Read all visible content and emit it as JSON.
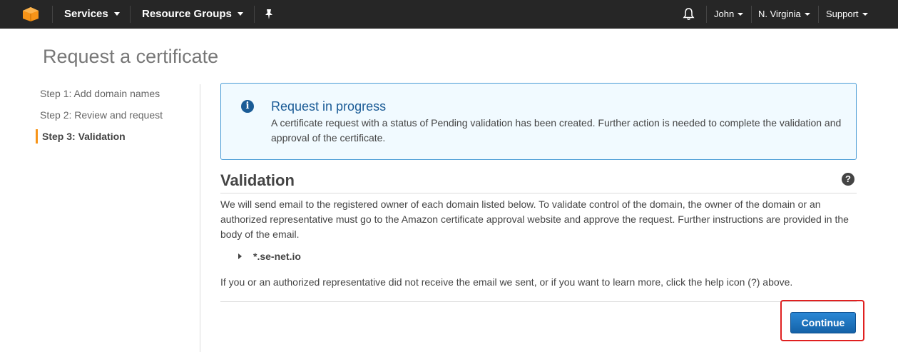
{
  "nav": {
    "logo_icon": "aws-cube-icon",
    "services_label": "Services",
    "resource_groups_label": "Resource Groups",
    "pin_icon": "pin-icon",
    "bell_icon": "bell-icon",
    "user_label": "John",
    "region_label": "N. Virginia",
    "support_label": "Support"
  },
  "page": {
    "title": "Request a certificate"
  },
  "steps": [
    {
      "label": "Step 1: Add domain names",
      "active": false
    },
    {
      "label": "Step 2: Review and request",
      "active": false
    },
    {
      "label": "Step 3: Validation",
      "active": true
    }
  ],
  "info": {
    "icon": "info-icon",
    "title": "Request in progress",
    "text": "A certificate request with a status of Pending validation has been created. Further action is needed to complete the validation and approval of the certificate."
  },
  "validation": {
    "title": "Validation",
    "help_icon": "help-icon",
    "description": "We will send email to the registered owner of each domain listed below. To validate control of the domain, the owner of the domain or an authorized representative must go to the Amazon certificate approval website and approve the request. Further instructions are provided in the body of the email.",
    "domain": "*.se-net.io",
    "note": "If you or an authorized representative did not receive the email we sent, or if you want to learn more, click the help icon (?) above."
  },
  "actions": {
    "continue_label": "Continue"
  },
  "colors": {
    "accent": "#f79418",
    "info_blue": "#1a5b96",
    "button_blue": "#1a6fba",
    "highlight_red": "#e02020"
  }
}
